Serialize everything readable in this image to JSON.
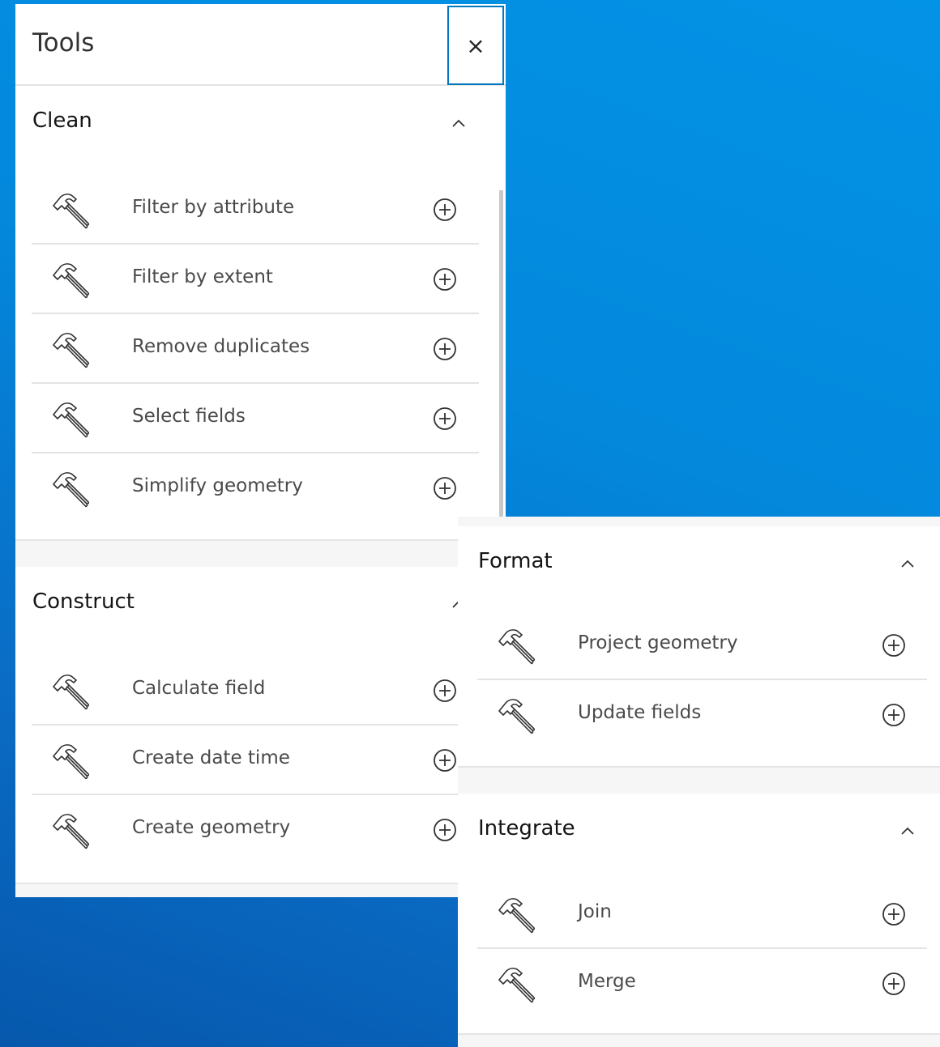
{
  "window": {
    "title": "Tools",
    "close_symbol": "×"
  },
  "colors": {
    "accent": "#0079c1",
    "background_blue": "#0388dc",
    "text": "#151515",
    "label": "#4a4a4a"
  },
  "icons": {
    "tool": "hammer-icon",
    "add": "plus-circle-icon",
    "collapse": "chevron-up-icon",
    "close": "close-icon"
  },
  "groups": {
    "clean": {
      "title": "Clean",
      "items": [
        {
          "label": "Filter by attribute"
        },
        {
          "label": "Filter by extent"
        },
        {
          "label": "Remove duplicates"
        },
        {
          "label": "Select fields"
        },
        {
          "label": "Simplify geometry"
        }
      ]
    },
    "construct": {
      "title": "Construct",
      "items": [
        {
          "label": "Calculate field"
        },
        {
          "label": "Create date time"
        },
        {
          "label": "Create geometry"
        }
      ]
    },
    "format": {
      "title": "Format",
      "items": [
        {
          "label": "Project geometry"
        },
        {
          "label": "Update fields"
        }
      ]
    },
    "integrate": {
      "title": "Integrate",
      "items": [
        {
          "label": "Join"
        },
        {
          "label": "Merge"
        }
      ]
    }
  }
}
